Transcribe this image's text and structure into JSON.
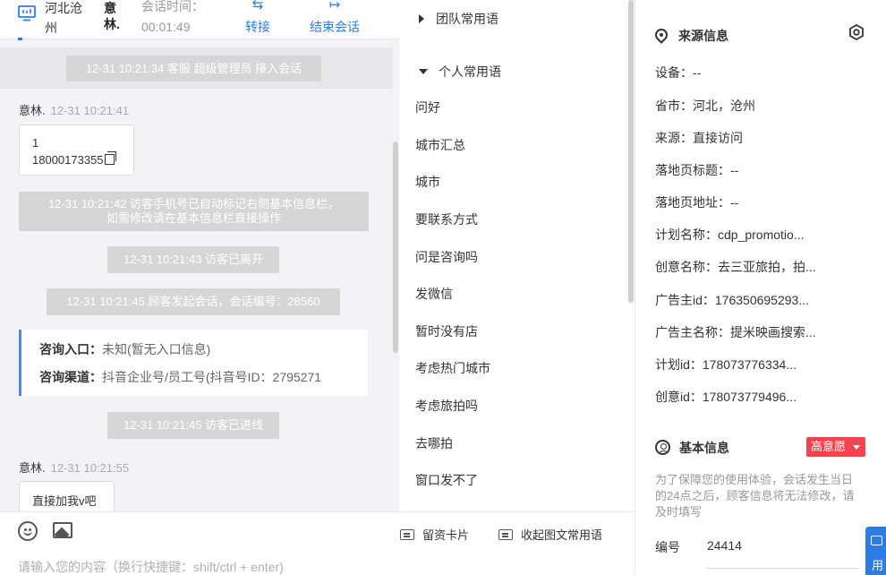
{
  "header": {
    "location": "河北沧州",
    "visitor_name": "意林.",
    "session_time_label": "会话时间：",
    "session_time_value": "00:01:49",
    "transfer_label": "转接",
    "end_session_label": "结束会话"
  },
  "messages": {
    "sys_agent_join": "12-31 10:21:34 客服 超级管理员 接入会话",
    "msg1_sender": "意林.",
    "msg1_time": "12-31 10:21:41",
    "msg1_line1": "1",
    "msg1_line2": "18000173355",
    "sys_phone_line1": "12-31 10:21:42 访客手机号已自动标记右侧基本信息栏，",
    "sys_phone_line2": "如需修改请在基本信息栏直接操作",
    "sys_left": "12-31 10:21:43 访客已离开",
    "sys_restart": "12-31 10:21:45 顾客发起会话，会话编号：28560",
    "entry_label": "咨询入口：",
    "entry_value": "未知(暂无入口信息)",
    "channel_label": "咨询渠道：",
    "channel_value": "抖音企业号/员工号(抖音号ID：2795271",
    "sys_entered": "12-31 10:21:45 访客已进线",
    "msg2_sender": "意林.",
    "msg2_time": "12-31 10:21:55",
    "msg2_text": "直接加我v吧"
  },
  "composer": {
    "card_label": "留资卡片",
    "collapse_label": "收起图文常用语",
    "placeholder": "请输入您的内容（换行快捷键：shift/ctrl + enter)"
  },
  "phrases": {
    "team_group": "团队常用语",
    "personal_group": "个人常用语",
    "items": [
      "问好",
      "城市汇总",
      "城市",
      "要联系方式",
      "问是咨询吗",
      "发微信",
      "暂时没有店",
      "考虑热门城市",
      "考虑旅拍吗",
      "去哪拍",
      "窗口发不了"
    ]
  },
  "source_info": {
    "title": "来源信息",
    "device": "设备：--",
    "province": "省市：河北，沧州",
    "source": "来源：直接访问",
    "landing_title": "落地页标题：--",
    "landing_url": "落地页地址：--",
    "plan_name": "计划名称：cdp_promotio...",
    "creative_name": "创意名称：去三亚旅拍，拍...",
    "advertiser_id": "广告主id：176350695293...",
    "advertiser_name": "广告主名称：提米映画搜索...",
    "plan_id": "计划id：178073776334...",
    "creative_id": "创意id：178073779496..."
  },
  "basic_info": {
    "title": "基本信息",
    "intent_tag": "高意愿",
    "notice": "为了保障您的使用体验，会话发生当日的24点之后，顾客信息将无法修改，请及时填写",
    "id_label": "编号",
    "id_value": "24414"
  },
  "float_button": {
    "label": "用"
  },
  "colors": {
    "accent": "#2d7ce6",
    "tag_red": "#f1444d",
    "system_pill": "#d6d6d6"
  }
}
